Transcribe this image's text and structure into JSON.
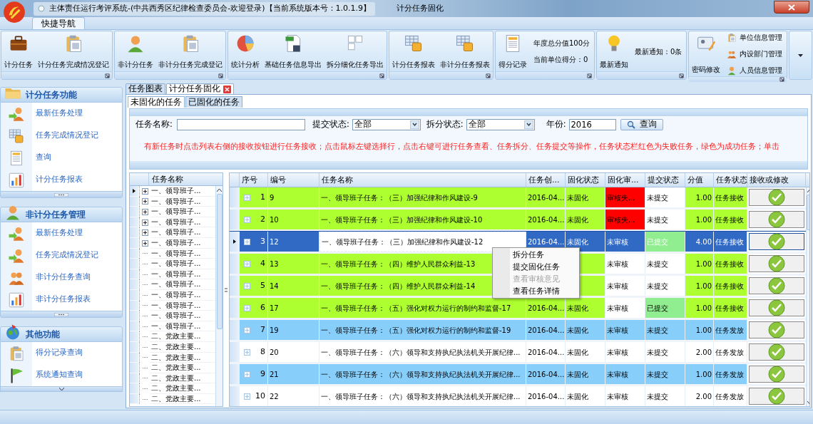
{
  "window": {
    "title": "主体责任运行考评系统-(中共西秀区纪律检查委员会-欢迎登录)【当前系统版本号：1.0.1.9】",
    "document_title": "计分任务固化"
  },
  "ribbon": {
    "tabs": [
      {
        "label": "快捷导航",
        "selected": true
      }
    ],
    "groups": [
      {
        "items": [
          {
            "kind": "large",
            "label": "计分任务"
          },
          {
            "kind": "large",
            "label": "计分任务完成情况登记"
          }
        ]
      },
      {
        "items": [
          {
            "kind": "large",
            "label": "非计分任务"
          },
          {
            "kind": "large",
            "label": "非计分任务完成登记"
          }
        ]
      },
      {
        "items": [
          {
            "kind": "large",
            "label": "统计分析"
          },
          {
            "kind": "large",
            "label": "基础任务信息导出"
          },
          {
            "kind": "large",
            "label": "拆分细化任务导出"
          }
        ]
      },
      {
        "items": [
          {
            "kind": "large",
            "label": "计分任务报表"
          },
          {
            "kind": "large",
            "label": "非计分任务报表"
          }
        ]
      },
      {
        "items": [
          {
            "kind": "large",
            "label": "得分记录"
          },
          {
            "kind": "text",
            "label": "年度总分值100分"
          },
          {
            "kind": "text",
            "label": "当前单位得分：0"
          }
        ]
      },
      {
        "items": [
          {
            "kind": "large",
            "label": "最新通知"
          },
          {
            "kind": "text",
            "label": "最新通知：0条"
          }
        ]
      },
      {
        "items": [
          {
            "kind": "large",
            "label": "密码修改"
          },
          {
            "kind": "small",
            "label": "单位信息管理"
          },
          {
            "kind": "small",
            "label": "内设部门管理"
          },
          {
            "kind": "small",
            "label": "人员信息管理"
          }
        ]
      }
    ]
  },
  "sidebar": {
    "sections": [
      {
        "title": "计分任务功能",
        "items": [
          {
            "label": "最新任务处理"
          },
          {
            "label": "任务完成情况登记"
          },
          {
            "label": "查询"
          },
          {
            "label": "计分任务报表"
          }
        ]
      },
      {
        "title": "非计分任务管理",
        "items": [
          {
            "label": "最新任务处理"
          },
          {
            "label": "任务完成情况登记"
          },
          {
            "label": "非计分任务查询"
          },
          {
            "label": "非计分任务报表"
          }
        ]
      },
      {
        "title": "其他功能",
        "items": [
          {
            "label": "得分记录查询"
          },
          {
            "label": "系统通知查询"
          }
        ]
      }
    ]
  },
  "document_tabs": [
    {
      "label": "任务图表",
      "selected": false,
      "closable": false
    },
    {
      "label": "计分任务固化",
      "selected": true,
      "closable": true
    }
  ],
  "sub_tabs": [
    {
      "label": "未固化的任务",
      "selected": true
    },
    {
      "label": "已固化的任务",
      "selected": false
    }
  ],
  "filter": {
    "task_name": {
      "label": "任务名称:"
    },
    "submit_state": {
      "label": "提交状态:",
      "value": "全部"
    },
    "split_state": {
      "label": "拆分状态:",
      "value": "全部"
    },
    "year": {
      "label": "年份:",
      "value": "2016"
    },
    "search_button": "查询",
    "hint": "有新任务时点击列表右侧的接收按钮进行任务接收；点击鼠标左键选择行，点击右键可进行任务查看、任务拆分、任务提交等操作，任务状态栏红色为失败任务，绿色为成功任务；单击"
  },
  "tree": {
    "header": "任务名称",
    "items": [
      {
        "label": "一、领导班子...",
        "expandable": true,
        "selected": true
      },
      {
        "label": "一、领导班子...",
        "expandable": true,
        "selected": false
      },
      {
        "label": "一、领导班子...",
        "expandable": true,
        "selected": false
      },
      {
        "label": "一、领导班子...",
        "expandable": true,
        "selected": false
      },
      {
        "label": "一、领导班子...",
        "expandable": true,
        "selected": false
      },
      {
        "label": "一、领导班子...",
        "expandable": true,
        "selected": false
      },
      {
        "label": "一、领导班子...",
        "expandable": false,
        "selected": false
      },
      {
        "label": "一、领导班子...",
        "expandable": false,
        "selected": false
      },
      {
        "label": "一、领导班子...",
        "expandable": false,
        "selected": false
      },
      {
        "label": "一、领导班子...",
        "expandable": false,
        "selected": false
      },
      {
        "label": "一、领导班子...",
        "expandable": false,
        "selected": false
      },
      {
        "label": "一、领导班子...",
        "expandable": false,
        "selected": false
      },
      {
        "label": "一、领导班子...",
        "expandable": false,
        "selected": false
      },
      {
        "label": "一、领导班子...",
        "expandable": false,
        "selected": false
      },
      {
        "label": "二、党政主要...",
        "expandable": false,
        "selected": false
      },
      {
        "label": "二、党政主要...",
        "expandable": false,
        "selected": false
      },
      {
        "label": "二、党政主要...",
        "expandable": false,
        "selected": false
      },
      {
        "label": "二、党政主要...",
        "expandable": false,
        "selected": false
      },
      {
        "label": "二、党政主要...",
        "expandable": false,
        "selected": false
      },
      {
        "label": "二、党政主要...",
        "expandable": false,
        "selected": false
      },
      {
        "label": "二、党政主要...",
        "expandable": false,
        "selected": false
      }
    ]
  },
  "grid": {
    "columns": [
      "序号",
      "编号",
      "任务名称",
      "任务创...",
      "固化状态",
      "固化审...",
      "提交状态",
      "分值",
      "任务状态",
      "接收或修改"
    ],
    "rows": [
      {
        "seq": "1",
        "code": "9",
        "name": "一、领导班子任务：（三）加强纪律和作风建设-9",
        "created": "2016-04...",
        "fix_state": "未固化",
        "audit": {
          "text": "审核失...",
          "color": "#ff0000"
        },
        "submit": {
          "text": "未提交",
          "color": "#ffffff"
        },
        "score": "1.00",
        "status": "任务接收",
        "color": "#adff2f",
        "selected": false
      },
      {
        "seq": "2",
        "code": "10",
        "name": "一、领导班子任务：（三）加强纪律和作风建设-10",
        "created": "2016-04...",
        "fix_state": "未固化",
        "audit": {
          "text": "审核失...",
          "color": "#ff0000"
        },
        "submit": {
          "text": "未提交",
          "color": "#ffffff"
        },
        "score": "1.00",
        "status": "任务接收",
        "color": "#adff2f",
        "selected": false
      },
      {
        "seq": "3",
        "code": "12",
        "name": "一、领导班子任务：（三）加强纪律和作风建设-12",
        "created": "2016-04...",
        "fix_state": "未固化",
        "audit": {
          "text": "未审核"
        },
        "submit": {
          "text": "已提交",
          "color": "#90ee90"
        },
        "score": "4.00",
        "status": "任务接收",
        "selected": true
      },
      {
        "seq": "4",
        "code": "13",
        "name": "一、领导班子任务：（四）维护人民群众利益-13",
        "audit": {
          "text": "未审核",
          "color": "#ffffff"
        },
        "submit": {
          "text": "未提交",
          "color": "#ffffff"
        },
        "score": "1.00",
        "status": "任务接收",
        "color": "#adff2f",
        "selected": false
      },
      {
        "seq": "5",
        "code": "14",
        "name": "一、领导班子任务：（四）维护人民群众利益-14",
        "audit": {
          "text": "未审核",
          "color": "#ffffff"
        },
        "submit": {
          "text": "未提交",
          "color": "#ffffff"
        },
        "score": "1.00",
        "status": "任务接收",
        "color": "#adff2f",
        "selected": false
      },
      {
        "seq": "6",
        "code": "17",
        "name": "一、领导班子任务：（五）强化对权力运行的制约和监督-17",
        "created": "2016-04...",
        "fix_state": "未固化",
        "audit": {
          "text": "未审核",
          "color": "#ffffff"
        },
        "submit": {
          "text": "已提交",
          "color": "#90ee90"
        },
        "score": "1.00",
        "status": "任务接收",
        "color": "#adff2f",
        "selected": false
      },
      {
        "seq": "7",
        "code": "19",
        "name": "一、领导班子任务：（五）强化对权力运行的制约和监督-19",
        "created": "2016-04...",
        "fix_state": "未固化",
        "audit": {
          "text": "未审核",
          "color": "#87cefa"
        },
        "submit": {
          "text": "未提交",
          "color": "#87cefa"
        },
        "score": "1.00",
        "status": "任务发放",
        "color": "#87cefa",
        "selected": false
      },
      {
        "seq": "8",
        "code": "20",
        "name": "一、领导班子任务：（六）领导和支持执纪执法机关开展纪律...",
        "created": "2016-04...",
        "fix_state": "未固化",
        "audit": {
          "text": "未审核",
          "color": "#ffffff"
        },
        "submit": {
          "text": "未提交",
          "color": "#ffffff"
        },
        "score": "2.00",
        "status": "任务发放",
        "color": "#ffffff",
        "selected": false
      },
      {
        "seq": "9",
        "code": "21",
        "name": "一、领导班子任务：（六）领导和支持执纪执法机关开展纪律...",
        "created": "2016-04...",
        "fix_state": "未固化",
        "audit": {
          "text": "未审核",
          "color": "#87cefa"
        },
        "submit": {
          "text": "未提交",
          "color": "#87cefa"
        },
        "score": "1.00",
        "status": "任务发放",
        "color": "#87cefa",
        "selected": false
      },
      {
        "seq": "10",
        "code": "22",
        "name": "一、领导班子任务：（六）领导和支持执纪执法机关开展纪律...",
        "created": "2016-04...",
        "fix_state": "未固化",
        "audit": {
          "text": "未审核",
          "color": "#ffffff"
        },
        "submit": {
          "text": "未提交",
          "color": "#ffffff"
        },
        "score": "2.00",
        "status": "任务发放",
        "color": "#ffffff",
        "selected": false
      }
    ]
  },
  "context_menu": {
    "items": [
      {
        "label": "拆分任务",
        "disabled": false
      },
      {
        "label": "提交固化任务",
        "disabled": false
      },
      {
        "label": "查看审核意见",
        "disabled": true
      },
      {
        "label": "查看任务详情",
        "disabled": false
      }
    ]
  }
}
